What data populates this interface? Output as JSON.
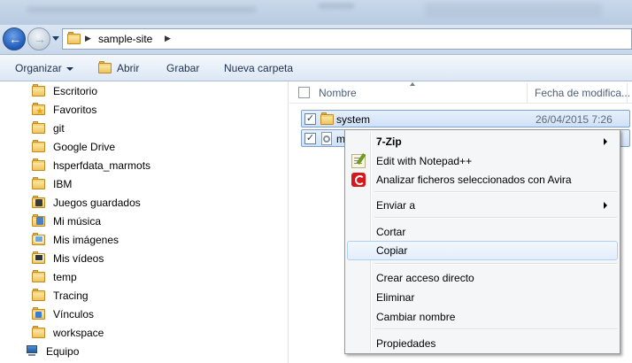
{
  "window": {
    "address": {
      "crumbs": [
        "sample-site"
      ]
    }
  },
  "toolbar": {
    "organize": "Organizar",
    "open": "Abrir",
    "burn": "Grabar",
    "new_folder": "Nueva carpeta"
  },
  "nav_pane": {
    "items": [
      {
        "label": "Escritorio",
        "icon": "folder-icon"
      },
      {
        "label": "Favoritos",
        "icon": "favorites-icon"
      },
      {
        "label": "git",
        "icon": "folder-icon"
      },
      {
        "label": "Google Drive",
        "icon": "folder-icon"
      },
      {
        "label": "hsperfdata_marmots",
        "icon": "folder-icon"
      },
      {
        "label": "IBM",
        "icon": "folder-icon"
      },
      {
        "label": "Juegos guardados",
        "icon": "saved-games-icon"
      },
      {
        "label": "Mi música",
        "icon": "music-folder-icon"
      },
      {
        "label": "Mis imágenes",
        "icon": "pictures-folder-icon"
      },
      {
        "label": "Mis vídeos",
        "icon": "videos-folder-icon"
      },
      {
        "label": "temp",
        "icon": "folder-icon"
      },
      {
        "label": "Tracing",
        "icon": "folder-icon"
      },
      {
        "label": "Vínculos",
        "icon": "links-folder-icon"
      },
      {
        "label": "workspace",
        "icon": "folder-icon"
      },
      {
        "label": "Equipo",
        "icon": "computer-icon"
      }
    ]
  },
  "content": {
    "columns": {
      "name": "Nombre",
      "date": "Fecha de modifica..."
    },
    "rows": [
      {
        "name": "system",
        "date": "26/04/2015 7:26",
        "checked": true,
        "icon": "folder-icon"
      },
      {
        "name": "m",
        "date": "",
        "checked": true,
        "icon": "file-icon"
      }
    ]
  },
  "context_menu": {
    "items": [
      {
        "label": "7-Zip",
        "bold": true,
        "submenu": true
      },
      {
        "label": "Edit with Notepad++",
        "icon": "notepadpp-icon"
      },
      {
        "label": "Analizar ficheros seleccionados con Avira",
        "icon": "avira-icon"
      },
      {
        "label": "Enviar a",
        "submenu": true
      },
      {
        "label": "Cortar"
      },
      {
        "label": "Copiar",
        "highlighted": true
      },
      {
        "label": "Crear acceso directo"
      },
      {
        "label": "Eliminar"
      },
      {
        "label": "Cambiar nombre"
      },
      {
        "label": "Propiedades"
      }
    ]
  },
  "colors": {
    "selection": "#cfe1f7",
    "menu_bg": "#f5f6f7",
    "avira": "#d9141b"
  }
}
